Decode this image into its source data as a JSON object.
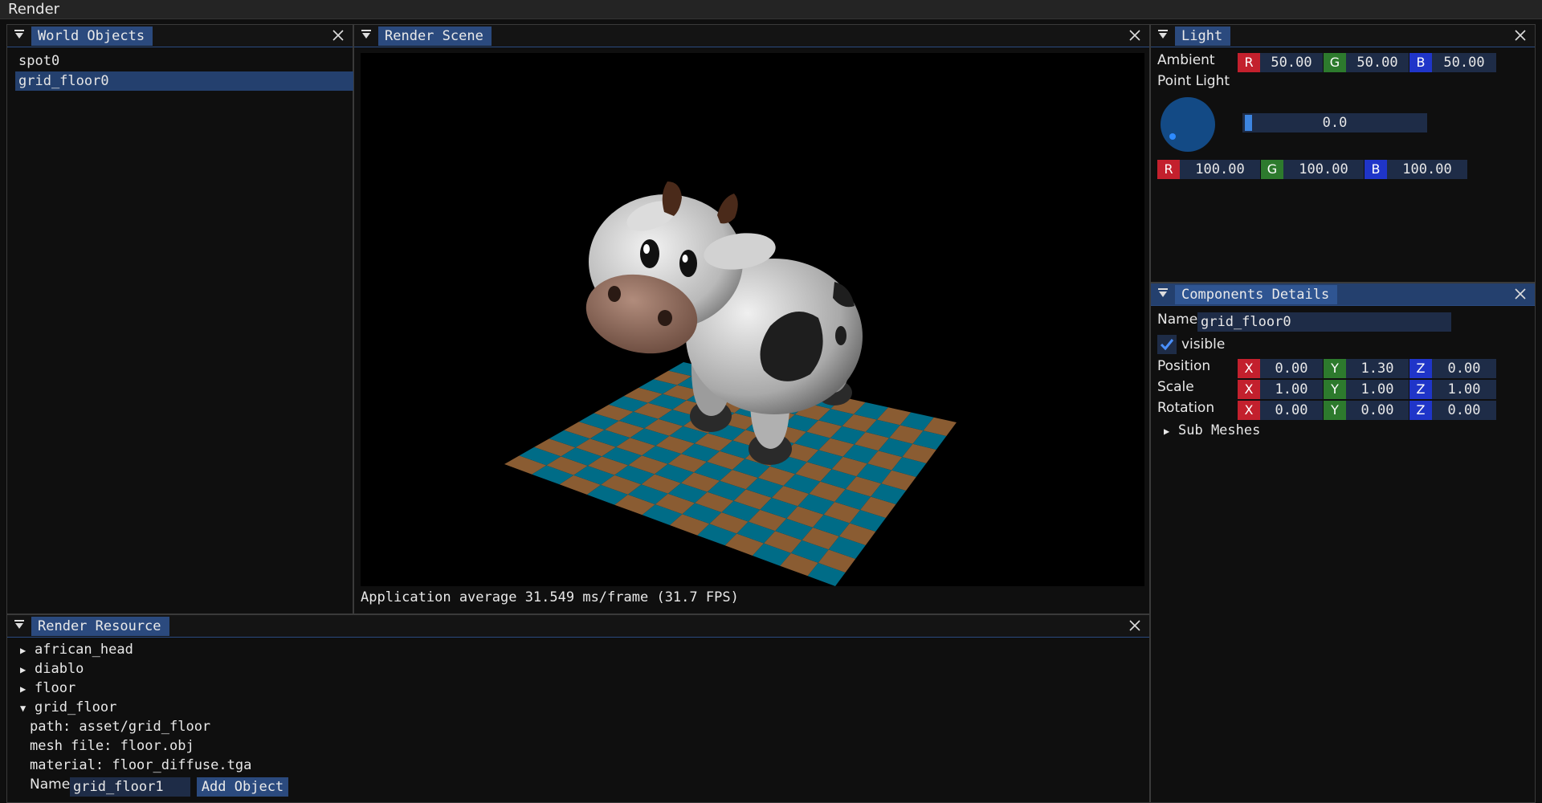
{
  "menubar": {
    "title": "Render"
  },
  "world_objects": {
    "title": "World Objects",
    "items": [
      {
        "label": "spot0",
        "selected": false
      },
      {
        "label": "grid_floor0",
        "selected": true
      }
    ]
  },
  "render_scene": {
    "title": "Render Scene",
    "status": "Application average 31.549 ms/frame (31.7 FPS)"
  },
  "light": {
    "title": "Light",
    "ambient_label": "Ambient",
    "ambient": {
      "r_label": "R",
      "r": "50.00",
      "g_label": "G",
      "g": "50.00",
      "b_label": "B",
      "b": "50.00"
    },
    "point_light_label": "Point Light",
    "slider_value": "0.0",
    "slider_fraction": 0.0,
    "point": {
      "r_label": "R",
      "r": "100.00",
      "g_label": "G",
      "g": "100.00",
      "b_label": "B",
      "b": "100.00"
    }
  },
  "components": {
    "title": "Components Details",
    "name_label": "Name",
    "name_value": "grid_floor0",
    "visible_label": "visible",
    "visible_checked": true,
    "position_label": "Position",
    "position": {
      "x_label": "X",
      "x": "0.00",
      "y_label": "Y",
      "y": "1.30",
      "z_label": "Z",
      "z": "0.00"
    },
    "scale_label": "Scale",
    "scale": {
      "x_label": "X",
      "x": "1.00",
      "y_label": "Y",
      "y": "1.00",
      "z_label": "Z",
      "z": "1.00"
    },
    "rotation_label": "Rotation",
    "rotation": {
      "x_label": "X",
      "x": "0.00",
      "y_label": "Y",
      "y": "0.00",
      "z_label": "Z",
      "z": "0.00"
    },
    "sub_meshes_label": "Sub Meshes"
  },
  "render_resource": {
    "title": "Render Resource",
    "tree": [
      {
        "label": "african_head",
        "expanded": false
      },
      {
        "label": "diablo",
        "expanded": false
      },
      {
        "label": "floor",
        "expanded": false
      },
      {
        "label": "grid_floor",
        "expanded": true
      }
    ],
    "details": {
      "path": "path: asset/grid_floor",
      "mesh": "mesh file: floor.obj",
      "material": "material: floor_diffuse.tga"
    },
    "name_label": "Name",
    "name_value": "grid_floor1",
    "add_button": "Add Object"
  },
  "colors": {
    "accent": "#2b4a7e",
    "checker_a": "#006c87",
    "checker_b": "#8a5c32",
    "red": "#c3202d",
    "green": "#2d7a2d",
    "blue": "#1f35c9"
  }
}
